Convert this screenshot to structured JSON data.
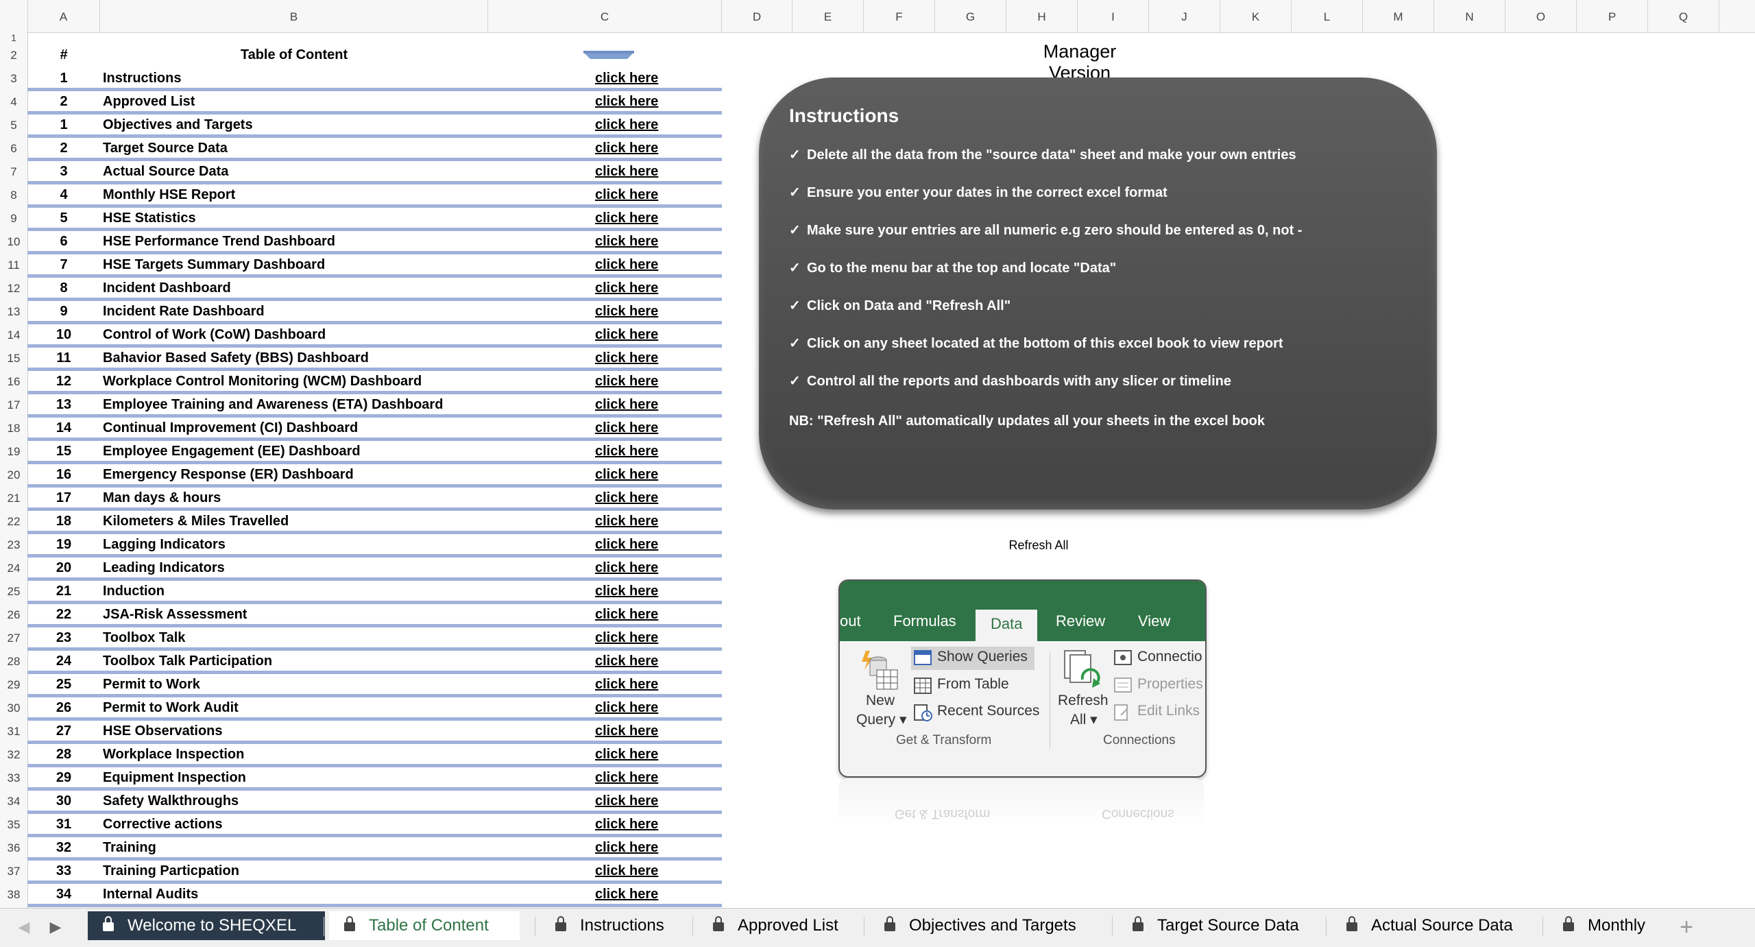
{
  "columns": [
    "A",
    "B",
    "C",
    "D",
    "E",
    "F",
    "G",
    "H",
    "I",
    "J",
    "K",
    "L",
    "M",
    "N",
    "O",
    "P",
    "Q"
  ],
  "rows": [
    "1",
    "2",
    "3",
    "4",
    "5",
    "6",
    "7",
    "8",
    "9",
    "10",
    "11",
    "12",
    "13",
    "14",
    "15",
    "16",
    "17",
    "18",
    "19",
    "20",
    "21",
    "22",
    "23",
    "24",
    "25",
    "26",
    "27",
    "28",
    "29",
    "30",
    "31",
    "32",
    "33",
    "34",
    "35",
    "36",
    "37",
    "38"
  ],
  "toc": {
    "num_header": "#",
    "title": "Table of Content",
    "items": [
      {
        "num": "1",
        "name": "Instructions",
        "link": "click here"
      },
      {
        "num": "2",
        "name": "Approved List",
        "link": "click here"
      },
      {
        "num": "1",
        "name": "Objectives and Targets",
        "link": "click here"
      },
      {
        "num": "2",
        "name": "Target Source Data",
        "link": "click here"
      },
      {
        "num": "3",
        "name": "Actual Source Data",
        "link": "click here"
      },
      {
        "num": "4",
        "name": "Monthly HSE Report",
        "link": "click here"
      },
      {
        "num": "5",
        "name": "HSE Statistics",
        "link": "click here"
      },
      {
        "num": "6",
        "name": "HSE Performance Trend Dashboard",
        "link": "click here"
      },
      {
        "num": "7",
        "name": "HSE Targets Summary Dashboard",
        "link": "click here"
      },
      {
        "num": "8",
        "name": "Incident Dashboard",
        "link": "click here"
      },
      {
        "num": "9",
        "name": "Incident Rate Dashboard",
        "link": "click here"
      },
      {
        "num": "10",
        "name": "Control of Work (CoW) Dashboard",
        "link": "click here"
      },
      {
        "num": "11",
        "name": "Bahavior Based Safety (BBS) Dashboard",
        "link": "click here"
      },
      {
        "num": "12",
        "name": "Workplace Control Monitoring (WCM) Dashboard",
        "link": "click here"
      },
      {
        "num": "13",
        "name": "Employee Training and Awareness (ETA) Dashboard",
        "link": "click here"
      },
      {
        "num": "14",
        "name": "Continual Improvement (CI) Dashboard",
        "link": "click here"
      },
      {
        "num": "15",
        "name": "Employee Engagement (EE) Dashboard",
        "link": "click here"
      },
      {
        "num": "16",
        "name": "Emergency Response (ER) Dashboard",
        "link": "click here"
      },
      {
        "num": "17",
        "name": "Man days & hours",
        "link": "click here"
      },
      {
        "num": "18",
        "name": "Kilometers & Miles Travelled",
        "link": "click here"
      },
      {
        "num": "19",
        "name": "Lagging Indicators",
        "link": "click here"
      },
      {
        "num": "20",
        "name": "Leading Indicators",
        "link": "click here"
      },
      {
        "num": "21",
        "name": "Induction",
        "link": "click here"
      },
      {
        "num": "22",
        "name": "JSA-Risk Assessment",
        "link": "click here"
      },
      {
        "num": "23",
        "name": "Toolbox Talk",
        "link": "click here"
      },
      {
        "num": "24",
        "name": "Toolbox Talk Participation",
        "link": "click here"
      },
      {
        "num": "25",
        "name": "Permit to Work",
        "link": "click here"
      },
      {
        "num": "26",
        "name": "Permit to Work Audit",
        "link": "click here"
      },
      {
        "num": "27",
        "name": "HSE Observations",
        "link": "click here"
      },
      {
        "num": "28",
        "name": "Workplace Inspection",
        "link": "click here"
      },
      {
        "num": "29",
        "name": "Equipment Inspection",
        "link": "click here"
      },
      {
        "num": "30",
        "name": "Safety Walkthroughs",
        "link": "click here"
      },
      {
        "num": "31",
        "name": "Corrective actions",
        "link": "click here"
      },
      {
        "num": "32",
        "name": "Training",
        "link": "click here"
      },
      {
        "num": "33",
        "name": "Training Particpation",
        "link": "click here"
      },
      {
        "num": "34",
        "name": "Internal Audits",
        "link": "click here"
      }
    ]
  },
  "manager_title": "Manager Version",
  "instructions": {
    "title": "Instructions",
    "tick": "✓",
    "items": [
      "Delete all the data from the \"source data\" sheet and make your own entries",
      "Ensure you enter your dates in the correct excel format",
      "Make sure your entries are all numeric e.g zero should be entered as 0, not -",
      "Go to the menu bar at the top and locate \"Data\"",
      "Click on Data and \"Refresh All\"",
      "Click on any sheet located at the bottom of this excel book to view report",
      "Control all the reports and dashboards with any slicer or timeline"
    ],
    "note": "NB: \"Refresh All\" automatically updates all your sheets in the excel book"
  },
  "refresh_caption": "Refresh All",
  "ribbon": {
    "tabs": [
      "out",
      "Formulas",
      "Data",
      "Review",
      "View"
    ],
    "active_tab": "Data",
    "new_query_line1": "New",
    "new_query_line2": "Query",
    "show_queries": "Show Queries",
    "from_table": "From Table",
    "recent_sources": "Recent Sources",
    "refresh_line1": "Refresh",
    "refresh_line2": "All",
    "connections": "Connectio",
    "properties": "Properties",
    "edit_links": "Edit Links",
    "group_get_transform": "Get & Transform",
    "group_connections": "Connections"
  },
  "sheet_tabs": [
    {
      "label": "Welcome to SHEQXEL",
      "state": "dark"
    },
    {
      "label": "Table of Content",
      "state": "active"
    },
    {
      "label": "Instructions",
      "state": "normal"
    },
    {
      "label": "Approved List",
      "state": "normal"
    },
    {
      "label": "Objectives and Targets",
      "state": "normal"
    },
    {
      "label": "Target Source Data",
      "state": "normal"
    },
    {
      "label": "Actual Source Data",
      "state": "normal"
    },
    {
      "label": "Monthly",
      "state": "normal"
    }
  ],
  "add_sheet_label": "+",
  "colors": {
    "accent_green": "#2f7446",
    "row_bar": "#9fb1da",
    "instr_bg": "#555555",
    "dark_tab": "#2a3a4a"
  }
}
